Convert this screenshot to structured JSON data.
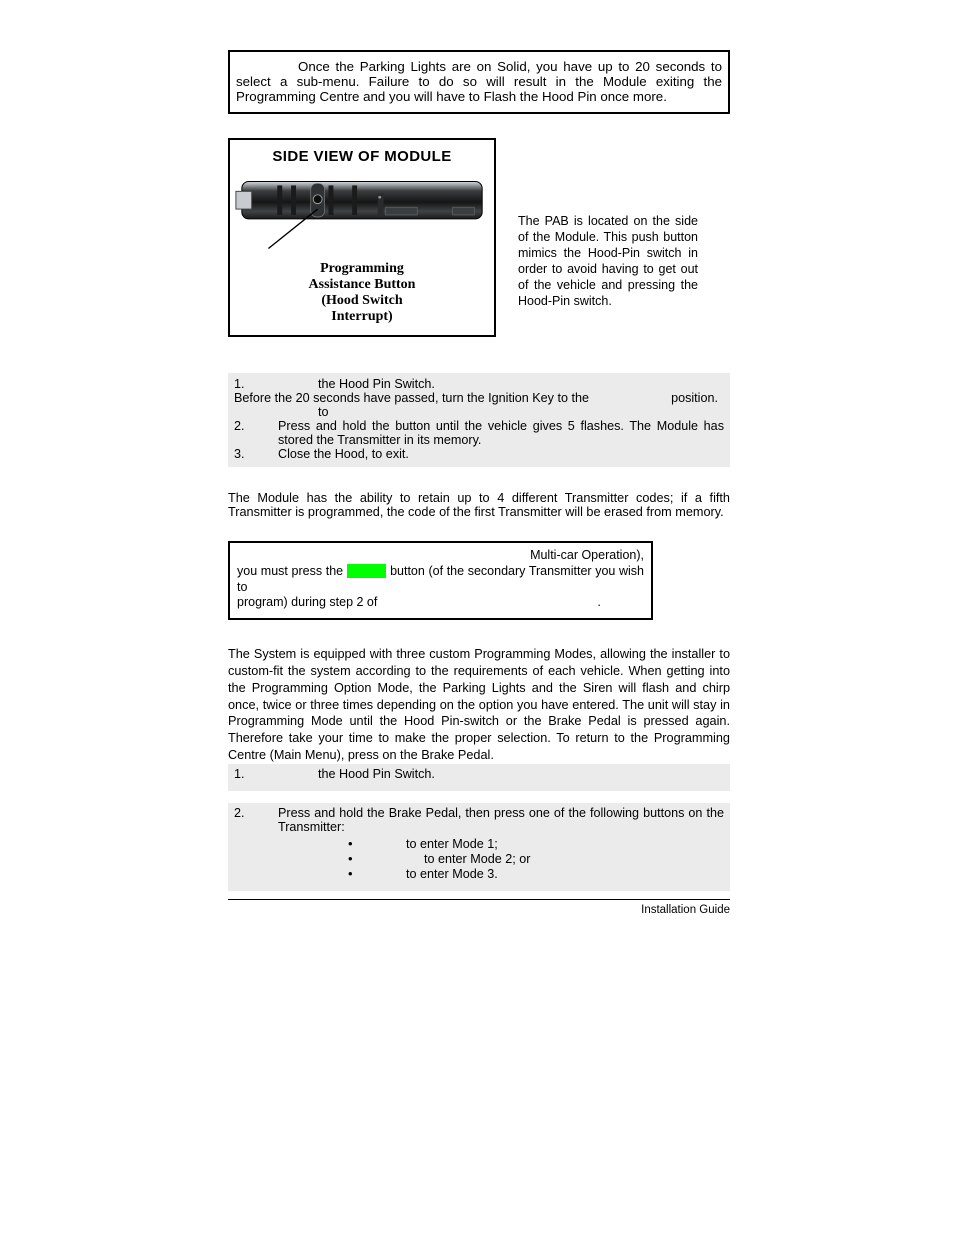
{
  "warning": {
    "text": "Once the Parking Lights are on Solid, you have up to 20 seconds to select a sub-menu. Failure to do so will result in the Module exiting the Programming Centre and you will have to Flash the Hood Pin once more."
  },
  "figure": {
    "title": "SIDE VIEW OF MODULE",
    "caption_l1": "Programming",
    "caption_l2": "Assistance Button",
    "caption_l3": "(Hood Switch",
    "caption_l4": "Interrupt)"
  },
  "pab_paragraph": "The PAB is located on the side of the Module.  This push button mimics the Hood-Pin switch in order to avoid having to get out of the vehicle and pressing the Hood-Pin switch.",
  "steps1": {
    "s1_num": "1.",
    "s1_txt": "the Hood Pin Switch.",
    "s1b": "Before the 20 seconds have passed, turn the Ignition Key to the",
    "s1b_pos": "position.",
    "s1c": "to",
    "s2_num": "2.",
    "s2_txt": "Press and hold the          button until the vehicle gives 5 flashes.  The Module has stored the Transmitter in its memory.",
    "s3_num": "3.",
    "s3_txt": "Close the Hood, to exit."
  },
  "limit_paragraph": "The Module has the ability to retain up to 4 different Transmitter codes; if a fifth Transmitter is programmed, the code of the first Transmitter will be erased from memory.",
  "multicar": {
    "top_right": "Multi-car Operation),",
    "line2_a": "you must press the ",
    "line2_b": "button (of the secondary Transmitter you wish to",
    "line3": "program) during step 2 of",
    "dot": "."
  },
  "modes_paragraph": "The System is equipped with three custom Programming Modes, allowing the installer to custom-fit the system according to the requirements of each vehicle.  When getting into the Programming Option Mode, the Parking Lights and the Siren will flash and chirp once, twice or three times depending on the option you have entered.  The unit will stay in Programming Mode until the Hood Pin-switch or the Brake Pedal is pressed again. Therefore take your time to make the proper selection.  To return to the Programming Centre (Main Menu), press on the Brake Pedal.",
  "steps2": {
    "s1_num": "1.",
    "s1_txt": "the Hood Pin Switch.",
    "s2_num": "2.",
    "s2_txt": "Press and hold the Brake Pedal, then press one of the following buttons on the Transmitter:",
    "m1": "to enter Mode 1;",
    "m2": "to enter Mode 2; or",
    "m3": "to enter Mode 3."
  },
  "footer": "Installation Guide"
}
